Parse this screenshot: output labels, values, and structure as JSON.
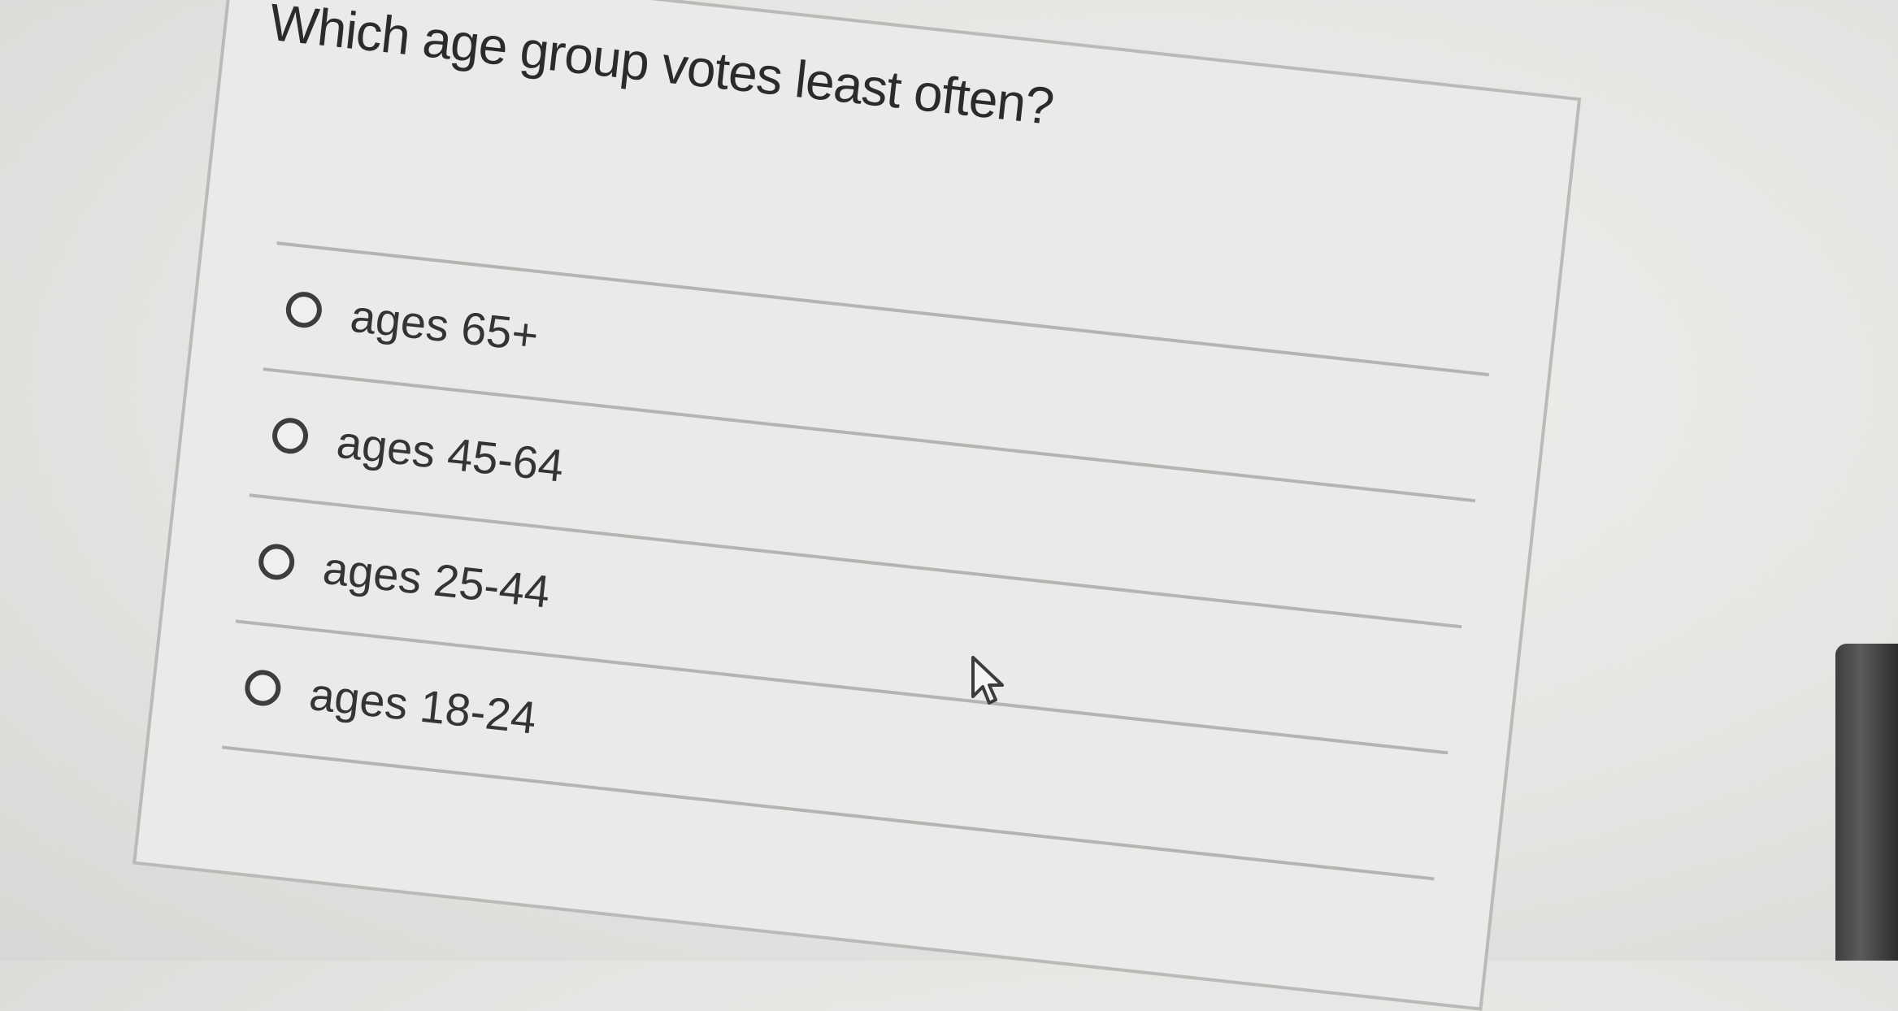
{
  "quiz": {
    "question": "Which age group votes least often?",
    "options": [
      {
        "label": "ages 65+",
        "selected": false
      },
      {
        "label": "ages 45-64",
        "selected": false
      },
      {
        "label": "ages 25-44",
        "selected": false
      },
      {
        "label": "ages 18-24",
        "selected": false
      }
    ]
  },
  "icons": {
    "cursor": "mouse-pointer-icon",
    "radio": "radio-button-unselected-icon"
  },
  "colors": {
    "background": "#e4e6e3",
    "card": "#e9ebe8",
    "text": "#2a2b2c",
    "divider": "#b3b5b2"
  }
}
